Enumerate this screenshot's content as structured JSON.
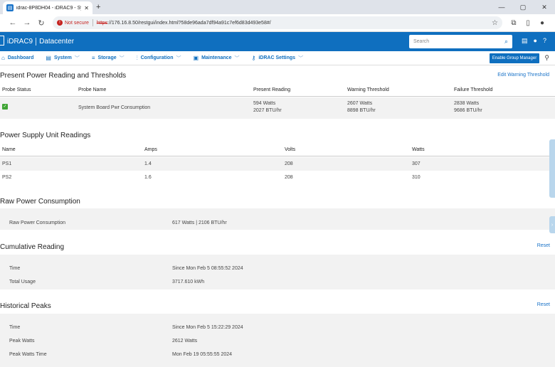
{
  "browser": {
    "tab_title": "idrac-8P8DH04 - iDRAC9 - Syst",
    "tab_close": "✕",
    "new_tab": "+",
    "window_controls": [
      "—",
      "▢",
      "✕"
    ],
    "not_secure": "Not secure",
    "url_scheme": "https",
    "url_rest": "://176.16.8.50/restgui/index.html?58de96ada7df94a91c7ef6d83d493e58#/"
  },
  "header": {
    "brand": "iDRAC9",
    "context": "Datacenter",
    "search_placeholder": "Search"
  },
  "menu": [
    {
      "label": "Dashboard",
      "icon": "home-icon"
    },
    {
      "label": "System",
      "icon": "server-icon"
    },
    {
      "label": "Storage",
      "icon": "database-icon"
    },
    {
      "label": "Configuration",
      "icon": "sliders-icon"
    },
    {
      "label": "Maintenance",
      "icon": "wrench-icon"
    },
    {
      "label": "iDRAC Settings",
      "icon": "key-icon"
    }
  ],
  "enable_group_manager": "Enable Group Manager",
  "power_thresholds": {
    "title": "Present Power Reading and Thresholds",
    "action": "Edit Warning Threshold",
    "columns": [
      "Probe Status",
      "Probe Name",
      "Present Reading",
      "Warning Threshold",
      "Failure Threshold"
    ],
    "row": {
      "probe_name": "System Board Pwr Consumption",
      "present_watts": "594 Watts",
      "present_btu": "2027 BTU/hr",
      "warning_watts": "2607 Watts",
      "warning_btu": "8898 BTU/hr",
      "failure_watts": "2838 Watts",
      "failure_btu": "9686 BTU/hr"
    }
  },
  "psu": {
    "title": "Power Supply Unit Readings",
    "columns": [
      "Name",
      "Amps",
      "Volts",
      "Watts"
    ],
    "rows": [
      {
        "name": "PS1",
        "amps": "1.4",
        "volts": "208",
        "watts": "307"
      },
      {
        "name": "PS2",
        "amps": "1.6",
        "volts": "208",
        "watts": "310"
      }
    ]
  },
  "raw": {
    "title": "Raw Power Consumption",
    "label": "Raw Power Consumption",
    "value": "617 Watts | 2106 BTU/hr"
  },
  "cumulative": {
    "title": "Cumulative Reading",
    "action": "Reset",
    "time_label": "Time",
    "time_value": "Since Mon Feb 5 08:55:52 2024",
    "usage_label": "Total Usage",
    "usage_value": "3717.610 kWh"
  },
  "peaks": {
    "title": "Historical Peaks",
    "action": "Reset",
    "time_label": "Time",
    "time_value": "Since Mon Feb 5 15:22:29 2024",
    "peak_watts_label": "Peak Watts",
    "peak_watts_value": "2612 Watts",
    "peak_time_label": "Peak Watts Time",
    "peak_time_value": "Mon Feb 19 05:55:55 2024"
  },
  "colors": {
    "brand_blue": "#0f6fbf",
    "ok_green": "#3fa535",
    "link_blue": "#1a73c8"
  }
}
